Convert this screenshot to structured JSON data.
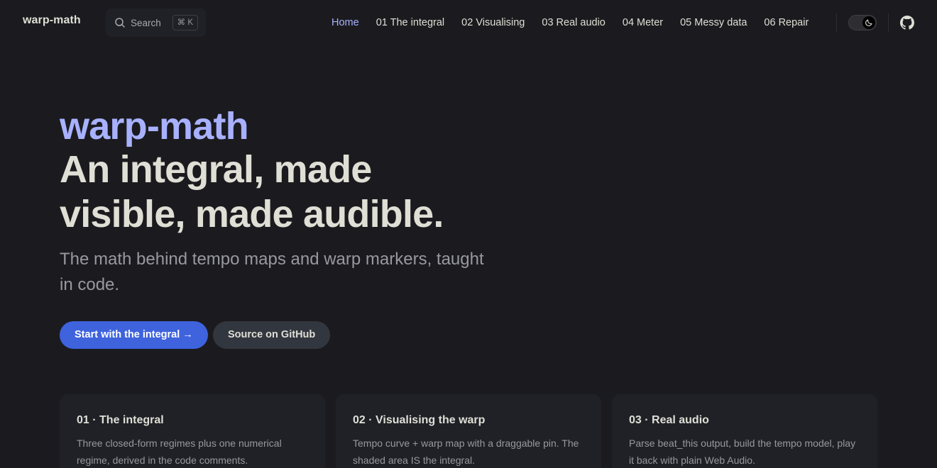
{
  "nav": {
    "brand": "warp-math",
    "search": {
      "label": "Search",
      "shortcut": "⌘ K"
    },
    "items": [
      {
        "label": "Home",
        "active": true
      },
      {
        "label": "01 The integral"
      },
      {
        "label": "02 Visualising"
      },
      {
        "label": "03 Real audio"
      },
      {
        "label": "04 Meter"
      },
      {
        "label": "05 Messy data"
      },
      {
        "label": "06 Repair"
      }
    ],
    "icons": {
      "theme": "moon-icon",
      "github": "github-icon",
      "search": "search-icon"
    }
  },
  "hero": {
    "name": "warp-math",
    "text": "An integral, made visible, made audible.",
    "tagline": "The math behind tempo maps and warp markers, taught in code.",
    "actions": {
      "primary": "Start with the integral →",
      "secondary": "Source on GitHub"
    }
  },
  "features": [
    {
      "title": "01 · The integral",
      "details": "Three closed-form regimes plus one numerical regime, derived in the code comments."
    },
    {
      "title": "02 · Visualising the warp",
      "details": "Tempo curve + warp map with a draggable pin. The shaded area IS the integral."
    },
    {
      "title": "03 · Real audio",
      "details": "Parse beat_this output, build the tempo model, play it back with plain Web Audio."
    }
  ],
  "colors": {
    "background": "#1b1b1f",
    "brand": "#a8b1ff",
    "primary_button": "#3e63dd",
    "card": "#202127"
  }
}
